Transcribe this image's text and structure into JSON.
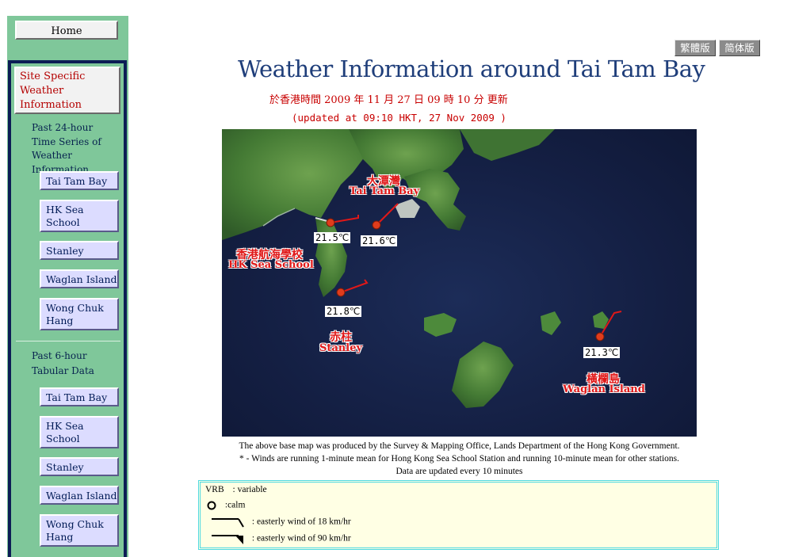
{
  "sidebar": {
    "home_label": "Home",
    "site_specific_label": "Site Specific Weather Information",
    "section1": {
      "heading": "Past 24-hour Time Series of Weather Information",
      "items": [
        "Tai Tam Bay",
        "HK Sea School",
        "Stanley",
        "Waglan Island",
        "Wong Chuk Hang"
      ]
    },
    "section2": {
      "heading": "Past 6-hour Tabular Data",
      "items": [
        "Tai Tam Bay",
        "HK Sea School",
        "Stanley",
        "Waglan Island",
        "Wong Chuk Hang"
      ]
    }
  },
  "header": {
    "lang_traditional": "繁體版",
    "lang_simplified": "简体版",
    "title": "Weather Information around Tai Tam Bay",
    "updated_zh": "於香港時間 2009 年 11 月 27  日 09  時 10 分 更新",
    "updated_en": "(updated at 09:10 HKT, 27 Nov 2009 )"
  },
  "map": {
    "stations": [
      {
        "id": "hk-sea-school",
        "temp": "21.5℃",
        "name_zh": "香港航海學校",
        "name_en": "HK Sea School"
      },
      {
        "id": "tai-tam-bay",
        "temp": "21.6℃",
        "name_zh": "大潭灣",
        "name_en": "Tai Tam Bay"
      },
      {
        "id": "stanley",
        "temp": "21.8℃",
        "name_zh": "赤柱",
        "name_en": "Stanley"
      },
      {
        "id": "waglan-island",
        "temp": "21.3℃",
        "name_zh": "橫欄島",
        "name_en": "Waglan Island"
      }
    ],
    "colors": {
      "sea": "#141f43",
      "land": "#4f8a3c",
      "station": "#e03c1c",
      "wind": "#e01818"
    }
  },
  "notes": {
    "base_map": "The above base map was produced by the Survey & Mapping Office, Lands Department of the Hong Kong Government.",
    "winds": "* - Winds are running 1-minute mean for Hong Kong Sea School Station and running 10-minute mean for other stations.",
    "update_freq": "Data are updated every 10 minutes"
  },
  "legend": {
    "vrb_key": "VRB",
    "vrb_text": ": variable",
    "calm_text": ":calm",
    "wind18_text": ": easterly wind of 18 km/hr",
    "wind90_text": ": easterly wind of 90 km/hr"
  }
}
